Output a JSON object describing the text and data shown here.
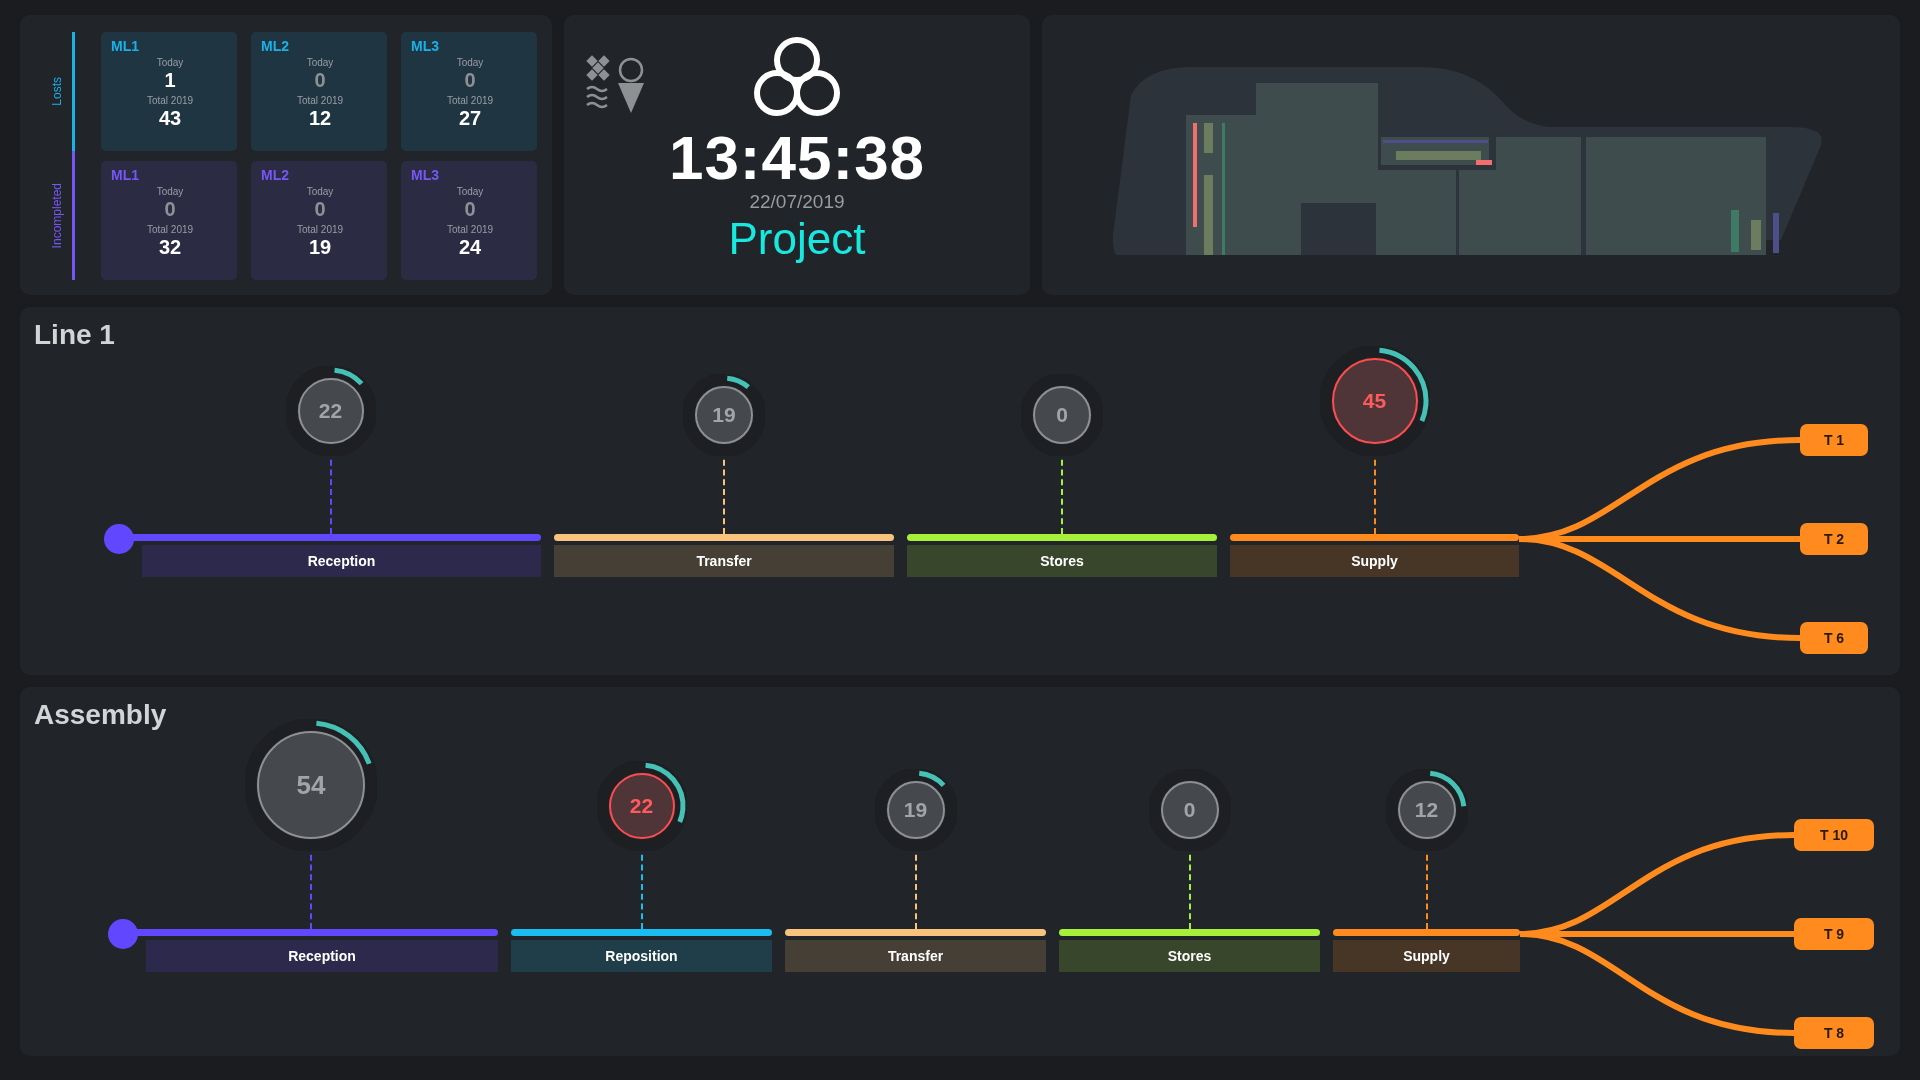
{
  "stats": {
    "groups": [
      {
        "label": "Losts",
        "color": "#1ab0e8",
        "cards": [
          {
            "title": "ML1",
            "today_label": "Today",
            "today": "1",
            "today_dimmed": false,
            "total_label": "Total 2019",
            "total": "43"
          },
          {
            "title": "ML2",
            "today_label": "Today",
            "today": "0",
            "today_dimmed": true,
            "total_label": "Total 2019",
            "total": "12"
          },
          {
            "title": "ML3",
            "today_label": "Today",
            "today": "0",
            "today_dimmed": true,
            "total_label": "Total 2019",
            "total": "27"
          }
        ]
      },
      {
        "label": "Incompleted",
        "color": "#7657f5",
        "cards": [
          {
            "title": "ML1",
            "today_label": "Today",
            "today": "0",
            "today_dimmed": true,
            "total_label": "Total 2019",
            "total": "32"
          },
          {
            "title": "ML2",
            "today_label": "Today",
            "today": "0",
            "today_dimmed": true,
            "total_label": "Total 2019",
            "total": "19"
          },
          {
            "title": "ML3",
            "today_label": "Today",
            "today": "0",
            "today_dimmed": true,
            "total_label": "Total 2019",
            "total": "24"
          }
        ]
      }
    ]
  },
  "clock": {
    "time": "13:45:38",
    "date": "22/07/2019",
    "project": "Project"
  },
  "sections": [
    {
      "title": "Line 1",
      "stages": [
        {
          "name": "Reception",
          "color": "#6148ff",
          "count": "22",
          "level": 0.12,
          "alert": false
        },
        {
          "name": "Transfer",
          "color": "#f8c37c",
          "count": "19",
          "level": 0.1,
          "alert": false
        },
        {
          "name": "Stores",
          "color": "#a6f03a",
          "count": "0",
          "level": 0,
          "alert": false
        },
        {
          "name": "Supply",
          "color": "#ff8a1e",
          "count": "45",
          "level": 0.3,
          "alert": true
        }
      ],
      "outputs": [
        "T 1",
        "T 2",
        "T 6"
      ]
    },
    {
      "title": "Assembly",
      "stages": [
        {
          "name": "Reception",
          "color": "#6148ff",
          "count": "54",
          "level": 0.18,
          "alert": false
        },
        {
          "name": "Reposition",
          "color": "#19bdf0",
          "count": "22",
          "level": 0.3,
          "alert": true
        },
        {
          "name": "Transfer",
          "color": "#f8c37c",
          "count": "19",
          "level": 0.12,
          "alert": false
        },
        {
          "name": "Stores",
          "color": "#a6f03a",
          "count": "0",
          "level": 0,
          "alert": false
        },
        {
          "name": "Supply",
          "color": "#ff8a1e",
          "count": "12",
          "level": 0.22,
          "alert": false
        }
      ],
      "outputs": [
        "T 10",
        "T 9",
        "T 8"
      ]
    }
  ]
}
